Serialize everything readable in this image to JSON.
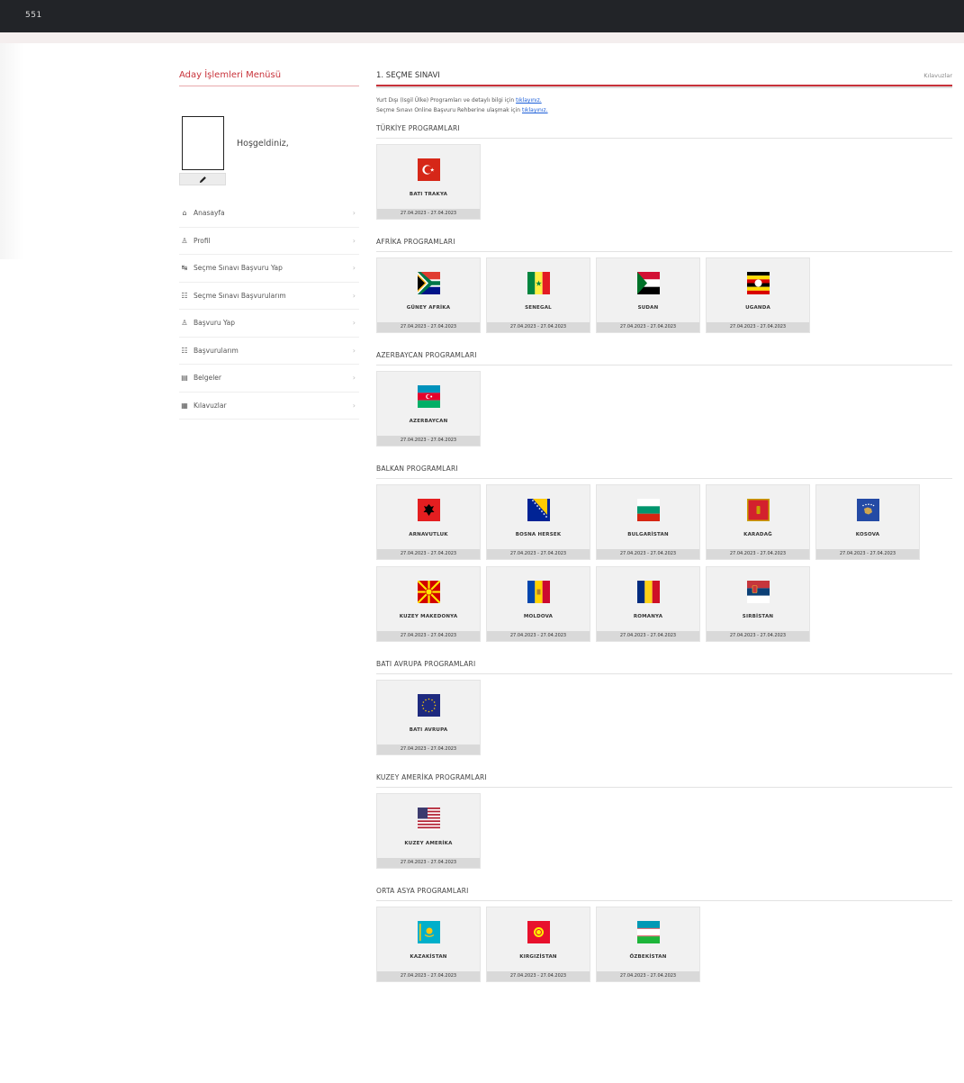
{
  "topbar": {
    "brand": "551"
  },
  "sidebar": {
    "title": "Aday İşlemleri Menüsü",
    "welcome": "Hoşgeldiniz,",
    "items": [
      {
        "label": "Anasayfa",
        "icon": "home-icon"
      },
      {
        "label": "Profil",
        "icon": "user-icon"
      },
      {
        "label": "Seçme Sınavı Başvuru Yap",
        "icon": "apply-icon"
      },
      {
        "label": "Seçme Sınavı Başvurularım",
        "icon": "list-icon"
      },
      {
        "label": "Başvuru Yap",
        "icon": "apply-user-icon"
      },
      {
        "label": "Başvurularım",
        "icon": "list-icon"
      },
      {
        "label": "Belgeler",
        "icon": "document-icon"
      },
      {
        "label": "Kılavuzlar",
        "icon": "book-icon"
      }
    ]
  },
  "main": {
    "title": "1. SEÇME SINAVI",
    "mini_link": "Kılavuzlar",
    "info_lines": [
      {
        "text": "Yurt Dışı (Isgil Ülke) Programları ve detaylı bilgi için",
        "link": "tıklayınız."
      },
      {
        "text": "Seçme Sınavı Online Başvuru Rehberine ulaşmak için",
        "link": "tıklayınız."
      }
    ],
    "sections": [
      {
        "title": "TÜRKİYE PROGRAMLARI",
        "cards": [
          {
            "name": "BATI TRAKYA",
            "flag": "turkey",
            "dates": "27.04.2023 - 27.04.2023"
          }
        ]
      },
      {
        "title": "AFRİKA PROGRAMLARI",
        "cards": [
          {
            "name": "GÜNEY AFRİKA",
            "flag": "south-africa",
            "dates": "27.04.2023 - 27.04.2023"
          },
          {
            "name": "SENEGAL",
            "flag": "senegal",
            "dates": "27.04.2023 - 27.04.2023"
          },
          {
            "name": "SUDAN",
            "flag": "sudan",
            "dates": "27.04.2023 - 27.04.2023"
          },
          {
            "name": "UGANDA",
            "flag": "uganda",
            "dates": "27.04.2023 - 27.04.2023"
          }
        ]
      },
      {
        "title": "AZERBAYCAN PROGRAMLARI",
        "cards": [
          {
            "name": "AZERBAYCAN",
            "flag": "azerbaijan",
            "dates": "27.04.2023 - 27.04.2023"
          }
        ]
      },
      {
        "title": "BALKAN PROGRAMLARI",
        "cards": [
          {
            "name": "ARNAVUTLUK",
            "flag": "albania",
            "dates": "27.04.2023 - 27.04.2023"
          },
          {
            "name": "BOSNA HERSEK",
            "flag": "bosnia",
            "dates": "27.04.2023 - 27.04.2023"
          },
          {
            "name": "BULGARİSTAN",
            "flag": "bulgaria",
            "dates": "27.04.2023 - 27.04.2023"
          },
          {
            "name": "KARADAĞ",
            "flag": "montenegro",
            "dates": "27.04.2023 - 27.04.2023"
          },
          {
            "name": "KOSOVA",
            "flag": "kosovo",
            "dates": "27.04.2023 - 27.04.2023"
          },
          {
            "name": "KUZEY MAKEDONYA",
            "flag": "north-macedonia",
            "dates": "27.04.2023 - 27.04.2023"
          },
          {
            "name": "MOLDOVA",
            "flag": "moldova",
            "dates": "27.04.2023 - 27.04.2023"
          },
          {
            "name": "ROMANYA",
            "flag": "romania",
            "dates": "27.04.2023 - 27.04.2023"
          },
          {
            "name": "SIRBİSTAN",
            "flag": "serbia",
            "dates": "27.04.2023 - 27.04.2023"
          }
        ]
      },
      {
        "title": "BATI AVRUPA PROGRAMLARI",
        "cards": [
          {
            "name": "BATI AVRUPA",
            "flag": "eu",
            "dates": "27.04.2023 - 27.04.2023"
          }
        ]
      },
      {
        "title": "KUZEY AMERİKA PROGRAMLARI",
        "cards": [
          {
            "name": "KUZEY AMERİKA",
            "flag": "usa",
            "dates": "27.04.2023 - 27.04.2023"
          }
        ]
      },
      {
        "title": "ORTA ASYA PROGRAMLARI",
        "cards": [
          {
            "name": "KAZAKİSTAN",
            "flag": "kazakhstan",
            "dates": "27.04.2023 - 27.04.2023"
          },
          {
            "name": "KIRGIZİSTAN",
            "flag": "kyrgyzstan",
            "dates": "27.04.2023 - 27.04.2023"
          },
          {
            "name": "ÖZBEKİSTAN",
            "flag": "uzbekistan",
            "dates": "27.04.2023 - 27.04.2023"
          }
        ]
      }
    ]
  },
  "colors": {
    "accent": "#c8323a",
    "topbar": "#222428",
    "card": "#f1f1f1",
    "date_strip": "#d9d9d9"
  }
}
